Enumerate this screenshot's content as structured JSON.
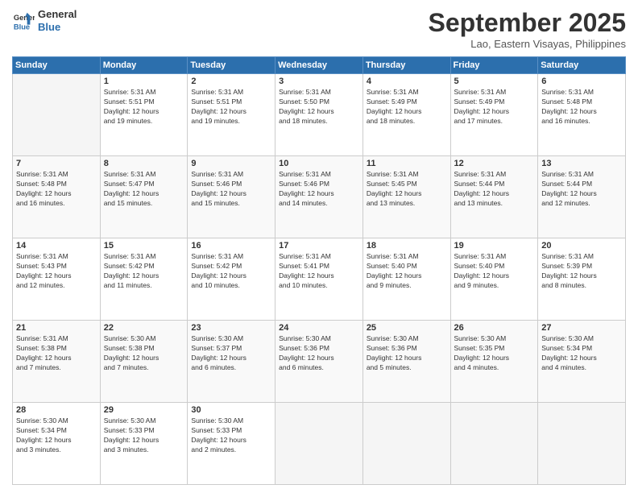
{
  "logo": {
    "line1": "General",
    "line2": "Blue"
  },
  "title": "September 2025",
  "subtitle": "Lao, Eastern Visayas, Philippines",
  "days_of_week": [
    "Sunday",
    "Monday",
    "Tuesday",
    "Wednesday",
    "Thursday",
    "Friday",
    "Saturday"
  ],
  "weeks": [
    [
      {
        "day": "",
        "info": ""
      },
      {
        "day": "1",
        "info": "Sunrise: 5:31 AM\nSunset: 5:51 PM\nDaylight: 12 hours\nand 19 minutes."
      },
      {
        "day": "2",
        "info": "Sunrise: 5:31 AM\nSunset: 5:51 PM\nDaylight: 12 hours\nand 19 minutes."
      },
      {
        "day": "3",
        "info": "Sunrise: 5:31 AM\nSunset: 5:50 PM\nDaylight: 12 hours\nand 18 minutes."
      },
      {
        "day": "4",
        "info": "Sunrise: 5:31 AM\nSunset: 5:49 PM\nDaylight: 12 hours\nand 18 minutes."
      },
      {
        "day": "5",
        "info": "Sunrise: 5:31 AM\nSunset: 5:49 PM\nDaylight: 12 hours\nand 17 minutes."
      },
      {
        "day": "6",
        "info": "Sunrise: 5:31 AM\nSunset: 5:48 PM\nDaylight: 12 hours\nand 16 minutes."
      }
    ],
    [
      {
        "day": "7",
        "info": "Sunrise: 5:31 AM\nSunset: 5:48 PM\nDaylight: 12 hours\nand 16 minutes."
      },
      {
        "day": "8",
        "info": "Sunrise: 5:31 AM\nSunset: 5:47 PM\nDaylight: 12 hours\nand 15 minutes."
      },
      {
        "day": "9",
        "info": "Sunrise: 5:31 AM\nSunset: 5:46 PM\nDaylight: 12 hours\nand 15 minutes."
      },
      {
        "day": "10",
        "info": "Sunrise: 5:31 AM\nSunset: 5:46 PM\nDaylight: 12 hours\nand 14 minutes."
      },
      {
        "day": "11",
        "info": "Sunrise: 5:31 AM\nSunset: 5:45 PM\nDaylight: 12 hours\nand 13 minutes."
      },
      {
        "day": "12",
        "info": "Sunrise: 5:31 AM\nSunset: 5:44 PM\nDaylight: 12 hours\nand 13 minutes."
      },
      {
        "day": "13",
        "info": "Sunrise: 5:31 AM\nSunset: 5:44 PM\nDaylight: 12 hours\nand 12 minutes."
      }
    ],
    [
      {
        "day": "14",
        "info": "Sunrise: 5:31 AM\nSunset: 5:43 PM\nDaylight: 12 hours\nand 12 minutes."
      },
      {
        "day": "15",
        "info": "Sunrise: 5:31 AM\nSunset: 5:42 PM\nDaylight: 12 hours\nand 11 minutes."
      },
      {
        "day": "16",
        "info": "Sunrise: 5:31 AM\nSunset: 5:42 PM\nDaylight: 12 hours\nand 10 minutes."
      },
      {
        "day": "17",
        "info": "Sunrise: 5:31 AM\nSunset: 5:41 PM\nDaylight: 12 hours\nand 10 minutes."
      },
      {
        "day": "18",
        "info": "Sunrise: 5:31 AM\nSunset: 5:40 PM\nDaylight: 12 hours\nand 9 minutes."
      },
      {
        "day": "19",
        "info": "Sunrise: 5:31 AM\nSunset: 5:40 PM\nDaylight: 12 hours\nand 9 minutes."
      },
      {
        "day": "20",
        "info": "Sunrise: 5:31 AM\nSunset: 5:39 PM\nDaylight: 12 hours\nand 8 minutes."
      }
    ],
    [
      {
        "day": "21",
        "info": "Sunrise: 5:31 AM\nSunset: 5:38 PM\nDaylight: 12 hours\nand 7 minutes."
      },
      {
        "day": "22",
        "info": "Sunrise: 5:30 AM\nSunset: 5:38 PM\nDaylight: 12 hours\nand 7 minutes."
      },
      {
        "day": "23",
        "info": "Sunrise: 5:30 AM\nSunset: 5:37 PM\nDaylight: 12 hours\nand 6 minutes."
      },
      {
        "day": "24",
        "info": "Sunrise: 5:30 AM\nSunset: 5:36 PM\nDaylight: 12 hours\nand 6 minutes."
      },
      {
        "day": "25",
        "info": "Sunrise: 5:30 AM\nSunset: 5:36 PM\nDaylight: 12 hours\nand 5 minutes."
      },
      {
        "day": "26",
        "info": "Sunrise: 5:30 AM\nSunset: 5:35 PM\nDaylight: 12 hours\nand 4 minutes."
      },
      {
        "day": "27",
        "info": "Sunrise: 5:30 AM\nSunset: 5:34 PM\nDaylight: 12 hours\nand 4 minutes."
      }
    ],
    [
      {
        "day": "28",
        "info": "Sunrise: 5:30 AM\nSunset: 5:34 PM\nDaylight: 12 hours\nand 3 minutes."
      },
      {
        "day": "29",
        "info": "Sunrise: 5:30 AM\nSunset: 5:33 PM\nDaylight: 12 hours\nand 3 minutes."
      },
      {
        "day": "30",
        "info": "Sunrise: 5:30 AM\nSunset: 5:33 PM\nDaylight: 12 hours\nand 2 minutes."
      },
      {
        "day": "",
        "info": ""
      },
      {
        "day": "",
        "info": ""
      },
      {
        "day": "",
        "info": ""
      },
      {
        "day": "",
        "info": ""
      }
    ]
  ]
}
